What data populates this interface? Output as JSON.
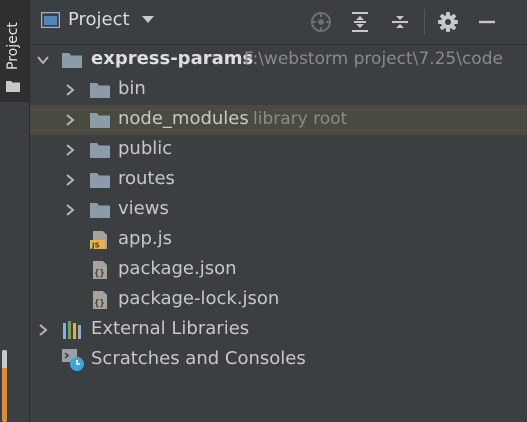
{
  "tool_strip": {
    "label": "Project"
  },
  "header": {
    "title": "Project"
  },
  "tree": {
    "root": {
      "label": "express-params",
      "path": "F:\\webstorm project\\7.25\\code"
    },
    "folders": [
      {
        "label": "bin",
        "hint": ""
      },
      {
        "label": "node_modules",
        "hint": "library root"
      },
      {
        "label": "public",
        "hint": ""
      },
      {
        "label": "routes",
        "hint": ""
      },
      {
        "label": "views",
        "hint": ""
      }
    ],
    "files": [
      {
        "label": "app.js",
        "icon": "js-file-icon"
      },
      {
        "label": "package.json",
        "icon": "json-file-icon"
      },
      {
        "label": "package-lock.json",
        "icon": "json-file-icon"
      }
    ],
    "external_libraries": "External Libraries",
    "scratches": "Scratches and Consoles"
  },
  "colors": {
    "background": "#3c3f41",
    "selection": "#4b4a41",
    "folder": "#8c9ba8",
    "accent_orange": "#e9892a",
    "badge_blue": "#3ba5d9"
  }
}
